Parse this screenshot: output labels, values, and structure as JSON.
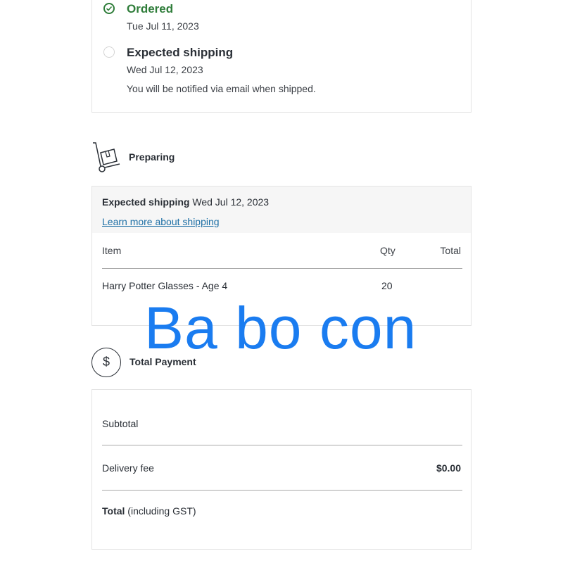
{
  "timeline": {
    "ordered": {
      "title": "Ordered",
      "date": "Tue Jul 11, 2023"
    },
    "expected": {
      "title": "Expected shipping",
      "date": "Wed Jul 12, 2023",
      "note": "You will be notified via email when shipped."
    }
  },
  "preparing": {
    "label": "Preparing",
    "icon": "hand-truck-icon"
  },
  "shipment": {
    "expected_label": "Expected shipping",
    "expected_date": "Wed Jul 12, 2023",
    "learn_more": "Learn more about shipping",
    "headers": {
      "item": "Item",
      "qty": "Qty",
      "total": "Total"
    },
    "rows": [
      {
        "item": "Harry Potter Glasses - Age 4",
        "qty": "20"
      }
    ]
  },
  "payment": {
    "label": "Total Payment",
    "icon": "dollar-icon",
    "subtotal_label": "Subtotal",
    "delivery_label": "Delivery fee",
    "delivery_value": "$0.00",
    "total_label_bold": "Total",
    "total_label_rest": "(including GST)"
  },
  "watermark": {
    "text": "Ba bo con"
  },
  "colors": {
    "success": "#2f7d3a",
    "link": "#1d6fa5",
    "watermark": "#1a7cf0"
  }
}
